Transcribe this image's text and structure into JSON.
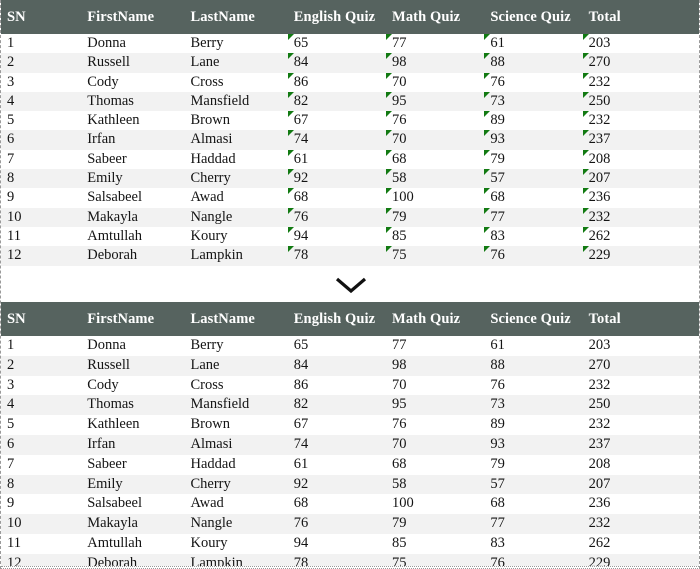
{
  "tables": {
    "columns": [
      "SN",
      "FirstName",
      "LastName",
      "English Quiz",
      "Math Quiz",
      "Science Quiz",
      "Total"
    ],
    "rows": [
      {
        "sn": "1",
        "first": "Donna",
        "last": "Berry",
        "english": "65",
        "math": "77",
        "science": "61",
        "total": "203"
      },
      {
        "sn": "2",
        "first": "Russell",
        "last": "Lane",
        "english": "84",
        "math": "98",
        "science": "88",
        "total": "270"
      },
      {
        "sn": "3",
        "first": "Cody",
        "last": "Cross",
        "english": "86",
        "math": "70",
        "science": "76",
        "total": "232"
      },
      {
        "sn": "4",
        "first": "Thomas",
        "last": "Mansfield",
        "english": "82",
        "math": "95",
        "science": "73",
        "total": "250"
      },
      {
        "sn": "5",
        "first": "Kathleen",
        "last": "Brown",
        "english": "67",
        "math": "76",
        "science": "89",
        "total": "232"
      },
      {
        "sn": "6",
        "first": "Irfan",
        "last": "Almasi",
        "english": "74",
        "math": "70",
        "science": "93",
        "total": "237"
      },
      {
        "sn": "7",
        "first": "Sabeer",
        "last": "Haddad",
        "english": "61",
        "math": "68",
        "science": "79",
        "total": "208"
      },
      {
        "sn": "8",
        "first": "Emily",
        "last": "Cherry",
        "english": "92",
        "math": "58",
        "science": "57",
        "total": "207"
      },
      {
        "sn": "9",
        "first": "Salsabeel",
        "last": "Awad",
        "english": "68",
        "math": "100",
        "science": "68",
        "total": "236"
      },
      {
        "sn": "10",
        "first": "Makayla",
        "last": "Nangle",
        "english": "76",
        "math": "79",
        "science": "77",
        "total": "232"
      },
      {
        "sn": "11",
        "first": "Amtullah",
        "last": "Koury",
        "english": "94",
        "math": "85",
        "science": "83",
        "total": "262"
      },
      {
        "sn": "12",
        "first": "Deborah",
        "last": "Lampkin",
        "english": "78",
        "math": "75",
        "science": "76",
        "total": "229"
      }
    ]
  },
  "divider": {
    "icon": "chevron-down-icon"
  },
  "style": {
    "header_background": "#56635f",
    "header_text": "#ffffff",
    "stripe_background": "#f2f2f2",
    "row_background": "#ffffff",
    "marker_color": "#127a12"
  }
}
